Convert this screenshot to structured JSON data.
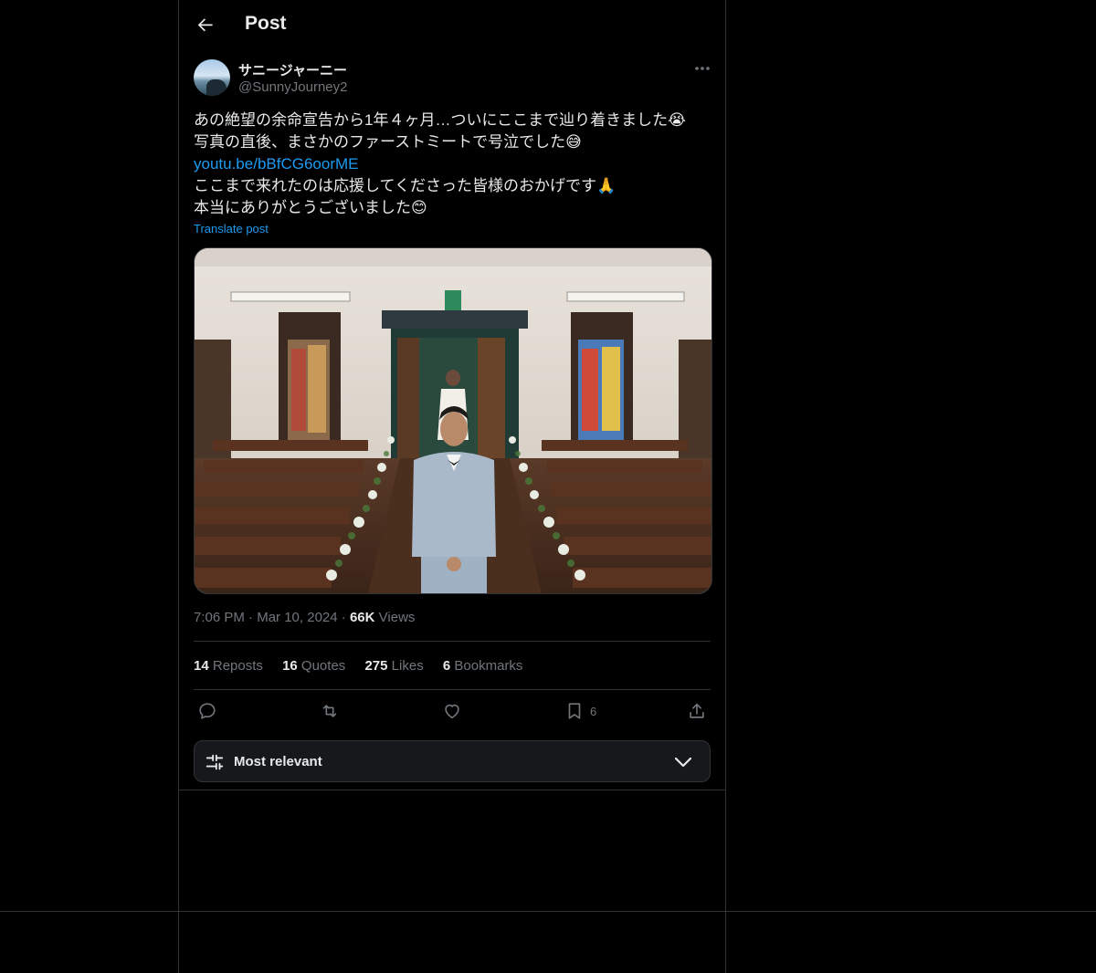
{
  "header": {
    "title": "Post"
  },
  "author": {
    "display_name": "サニージャーニー",
    "handle": "@SunnyJourney2"
  },
  "post": {
    "lines": [
      "あの絶望の余命宣告から1年４ヶ月…ついにここまで辿り着きました😭",
      "写真の直後、まさかのファーストミートで号泣でした😅",
      "youtu.be/bBfCG6oorME",
      "ここまで来れたのは応援してくださった皆様のおかげです🙏",
      "本当にありがとうございました😊"
    ],
    "link": "youtu.be/bBfCG6oorME",
    "translate_label": "Translate post"
  },
  "meta": {
    "time": "7:06 PM",
    "date": "Mar 10, 2024",
    "views_count": "66K",
    "views_label": "Views",
    "separator": "·"
  },
  "stats": {
    "reposts_count": "14",
    "reposts_label": "Reposts",
    "quotes_count": "16",
    "quotes_label": "Quotes",
    "likes_count": "275",
    "likes_label": "Likes",
    "bookmarks_count": "6",
    "bookmarks_label": "Bookmarks"
  },
  "actions": {
    "bookmark_count": "6"
  },
  "sort": {
    "label": "Most relevant"
  },
  "icons": {
    "back": "arrow-left-icon",
    "more": "more-horizontal-icon",
    "reply": "reply-icon",
    "repost": "repost-icon",
    "like": "heart-icon",
    "bookmark": "bookmark-icon",
    "share": "share-icon",
    "sort": "sliders-icon",
    "chevron": "chevron-down-icon"
  },
  "colors": {
    "background": "#000000",
    "text": "#e7e9ea",
    "muted": "#71767b",
    "link": "#1d9bf0",
    "border": "#2f3336"
  }
}
